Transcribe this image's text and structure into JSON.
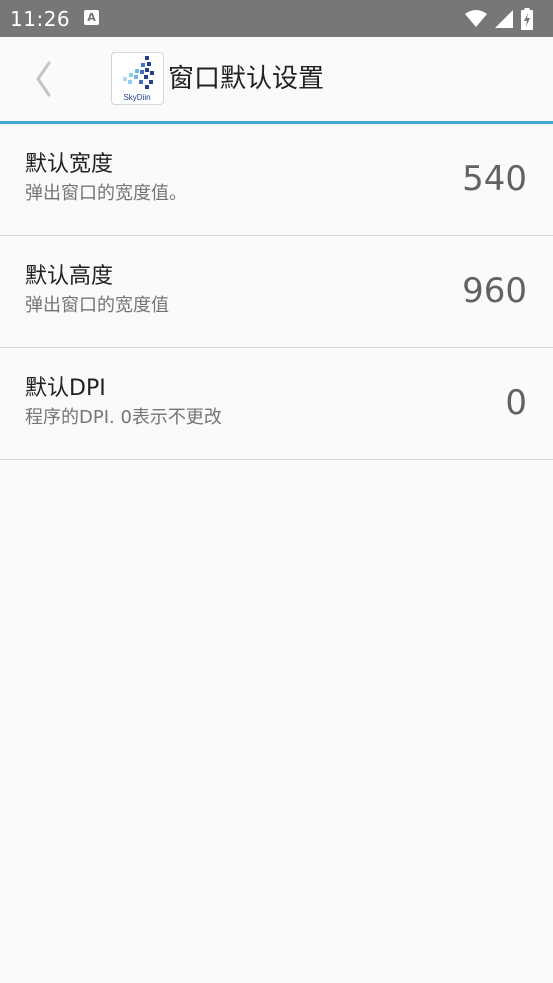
{
  "status_bar": {
    "time": "11:26",
    "notification_letter": "A",
    "icons": [
      "wifi-icon",
      "signal-icon",
      "battery-charging-icon"
    ]
  },
  "app_bar": {
    "title": "窗口默认设置",
    "back_icon": "chevron-left-icon",
    "logo_text": "SkyDiin"
  },
  "colors": {
    "status_bar": "#777777",
    "accent": "#42a5d6",
    "background": "#fafafa"
  },
  "preferences": [
    {
      "title": "默认宽度",
      "summary": "弹出窗口的宽度值。",
      "value": "540"
    },
    {
      "title": "默认高度",
      "summary": "弹出窗口的宽度值",
      "value": "960"
    },
    {
      "title": "默认DPI",
      "summary": "程序的DPI. 0表示不更改",
      "value": "0"
    }
  ]
}
